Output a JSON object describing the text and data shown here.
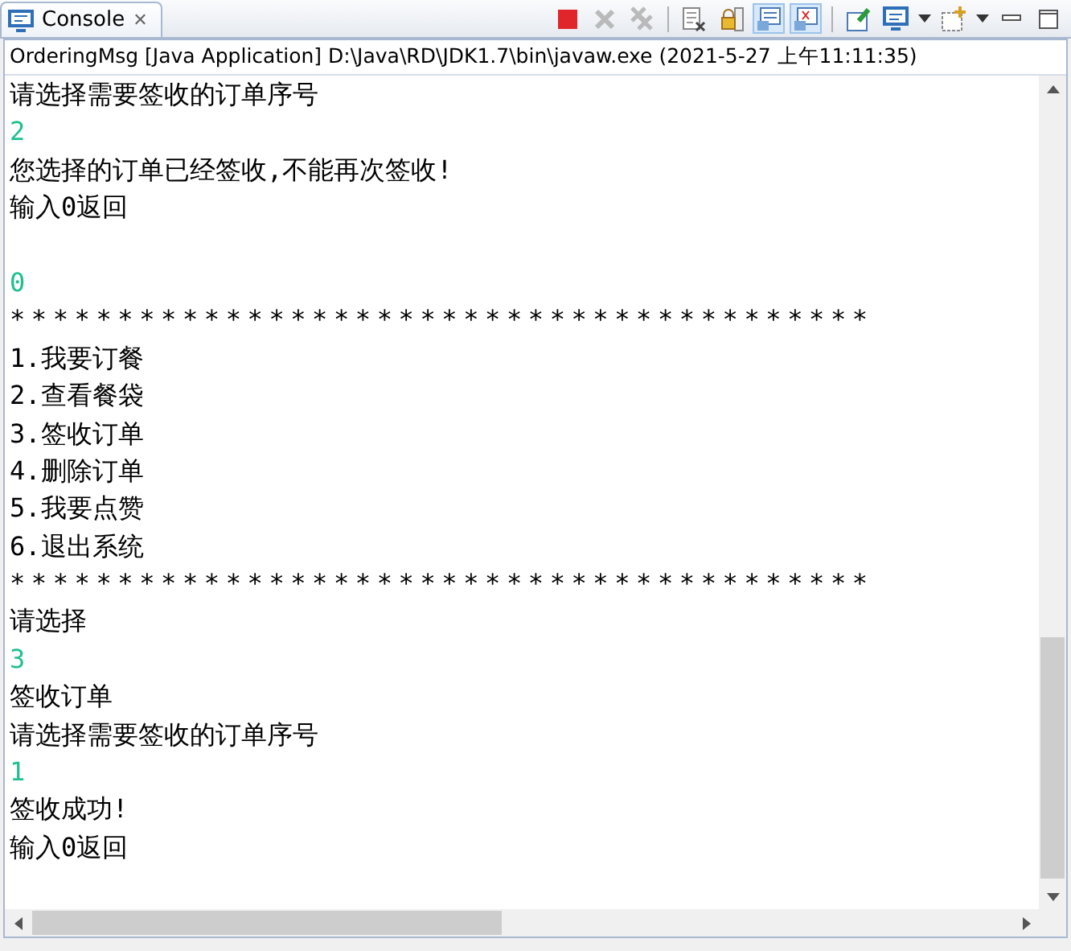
{
  "tab": {
    "title": "Console",
    "close": "✕"
  },
  "toolbar": [
    {
      "kind": "stop",
      "disabled": false
    },
    {
      "kind": "remove",
      "disabled": true
    },
    {
      "kind": "remove-all",
      "disabled": true
    },
    {
      "kind": "separator"
    },
    {
      "kind": "clear"
    },
    {
      "kind": "scroll-lock",
      "selected": false
    },
    {
      "kind": "stdout",
      "selected": true
    },
    {
      "kind": "stderr",
      "selected": true
    },
    {
      "kind": "separator"
    },
    {
      "kind": "pin",
      "selected": false
    },
    {
      "kind": "display"
    },
    {
      "kind": "dropdown"
    },
    {
      "kind": "open-console"
    },
    {
      "kind": "dropdown"
    },
    {
      "kind": "minimize"
    },
    {
      "kind": "maximize"
    }
  ],
  "process": "OrderingMsg [Java Application] D:\\Java\\RD\\JDK1.7\\bin\\javaw.exe (2021-5-27 上午11:11:35)",
  "lines": [
    {
      "kind": "output",
      "text": "请选择需要签收的订单序号"
    },
    {
      "kind": "input",
      "text": "2"
    },
    {
      "kind": "output",
      "text": "您选择的订单已经签收,不能再次签收!"
    },
    {
      "kind": "output",
      "text": "输入0返回"
    },
    {
      "kind": "blank"
    },
    {
      "kind": "input",
      "text": "0"
    },
    {
      "kind": "rule",
      "text": "****************************************"
    },
    {
      "kind": "output",
      "text": "1.我要订餐"
    },
    {
      "kind": "output",
      "text": "2.查看餐袋"
    },
    {
      "kind": "output",
      "text": "3.签收订单"
    },
    {
      "kind": "output",
      "text": "4.删除订单"
    },
    {
      "kind": "output",
      "text": "5.我要点赞"
    },
    {
      "kind": "output",
      "text": "6.退出系统"
    },
    {
      "kind": "rule",
      "text": "****************************************"
    },
    {
      "kind": "output",
      "text": "请选择"
    },
    {
      "kind": "input",
      "text": "3"
    },
    {
      "kind": "output",
      "text": "签收订单"
    },
    {
      "kind": "output",
      "text": "请选择需要签收的订单序号"
    },
    {
      "kind": "input",
      "text": "1"
    },
    {
      "kind": "output",
      "text": "签收成功!"
    },
    {
      "kind": "output",
      "text": "输入0返回"
    }
  ]
}
